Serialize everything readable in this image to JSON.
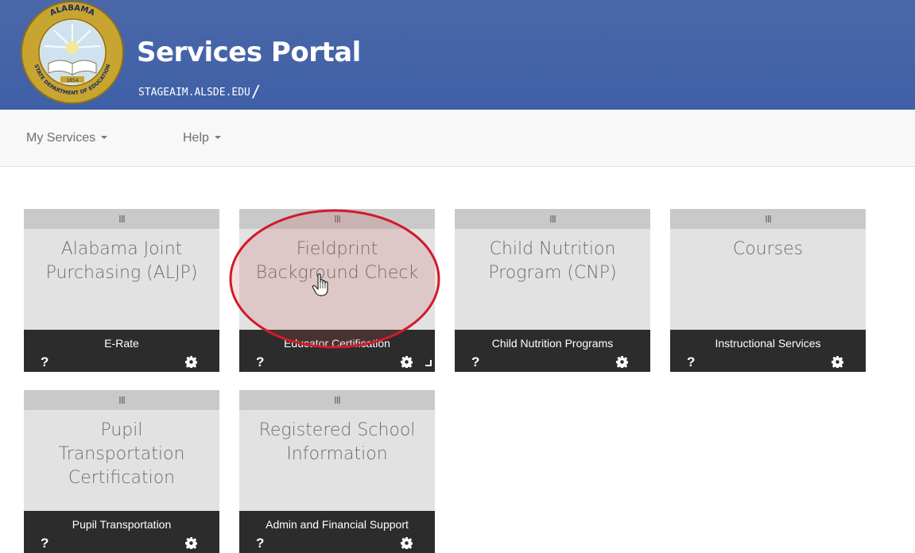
{
  "header": {
    "title": "Services Portal",
    "subtitle": "STAGEAIM.ALSDE.EDU",
    "subtitle_suffix": "/",
    "seal": {
      "icon": "alabama-state-department-of-education-seal-icon",
      "text_top": "ALABAMA",
      "text_bottom": "STATE DEPARTMENT OF EDUCATION",
      "year": "1854"
    },
    "colors": {
      "background": "#4a67a8",
      "text": "#ffffff"
    }
  },
  "nav": {
    "items": [
      {
        "label": "My Services"
      },
      {
        "label": "Help"
      }
    ]
  },
  "tiles": [
    {
      "handle": "III",
      "title": [
        "Alabama Joint",
        "Purchasing (ALJP)"
      ],
      "category": "E-Rate",
      "help": "?"
    },
    {
      "handle": "III",
      "title": [
        "Fieldprint",
        "Background Check"
      ],
      "category": "Educator Certification",
      "help": "?"
    },
    {
      "handle": "III",
      "title": [
        "Child Nutrition",
        "Program (CNP)"
      ],
      "category": "Child Nutrition Programs",
      "help": "?"
    },
    {
      "handle": "III",
      "title": [
        "Courses"
      ],
      "category": "Instructional Services",
      "help": "?"
    },
    {
      "handle": "III",
      "title": [
        "Pupil",
        "Transportation",
        "Certification"
      ],
      "category": "Pupil Transportation",
      "help": "?"
    },
    {
      "handle": "III",
      "title": [
        "Registered School",
        "Information"
      ],
      "category": "Admin and Financial Support",
      "help": "?"
    }
  ],
  "annotation": {
    "color": "#d11a2a",
    "fill": "rgba(200,80,80,0.18)"
  },
  "icons": [
    "caret-down-icon",
    "help-icon",
    "gear-icon",
    "resize-icon",
    "hand-cursor-icon"
  ]
}
